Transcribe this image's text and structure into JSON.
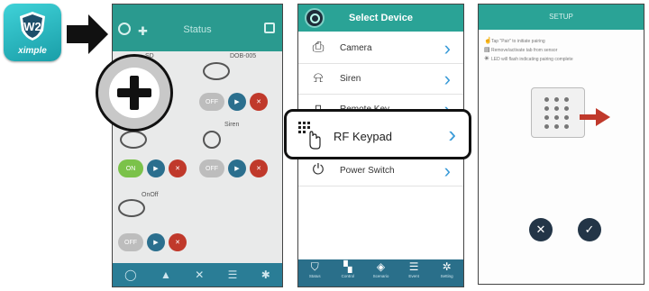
{
  "app_icon": {
    "brand": "ximple",
    "monogram": "W2",
    "color": "#27b5bd"
  },
  "phone1": {
    "title": "Status",
    "devices": [
      {
        "name": "SD"
      },
      {
        "name": "DOB-005"
      },
      {
        "name": "Siren"
      },
      {
        "name": "OnOff"
      }
    ],
    "buttons": {
      "off": "OFF",
      "on": "ON"
    },
    "nav": [
      "Status",
      "Control",
      "Scenario",
      "Event",
      "Setting"
    ]
  },
  "phone2": {
    "title": "Select Device",
    "items": [
      {
        "label": "Camera",
        "icon": "camera-icon"
      },
      {
        "label": "Siren",
        "icon": "siren-icon"
      },
      {
        "label": "Remote Key",
        "icon": "remote-key-icon"
      },
      {
        "label": "RF Keypad",
        "icon": "keypad-icon"
      },
      {
        "label": "Power Switch",
        "icon": "power-switch-icon"
      }
    ],
    "nav": [
      "Status",
      "Control",
      "Scenario",
      "Event",
      "Setting"
    ]
  },
  "callout": {
    "label": "RF Keypad"
  },
  "phone3": {
    "title": "SETUP",
    "steps": [
      "Tap \"Pair\" to initiate pairing",
      "Remove/activate tab from sensor",
      "LED will flash indicating pairing complete"
    ],
    "cancel": "✕",
    "ok": "✓"
  },
  "colors": {
    "teal": "#2aa396",
    "nav_blue": "#2a6f8a",
    "chevron": "#3a9bd8"
  }
}
